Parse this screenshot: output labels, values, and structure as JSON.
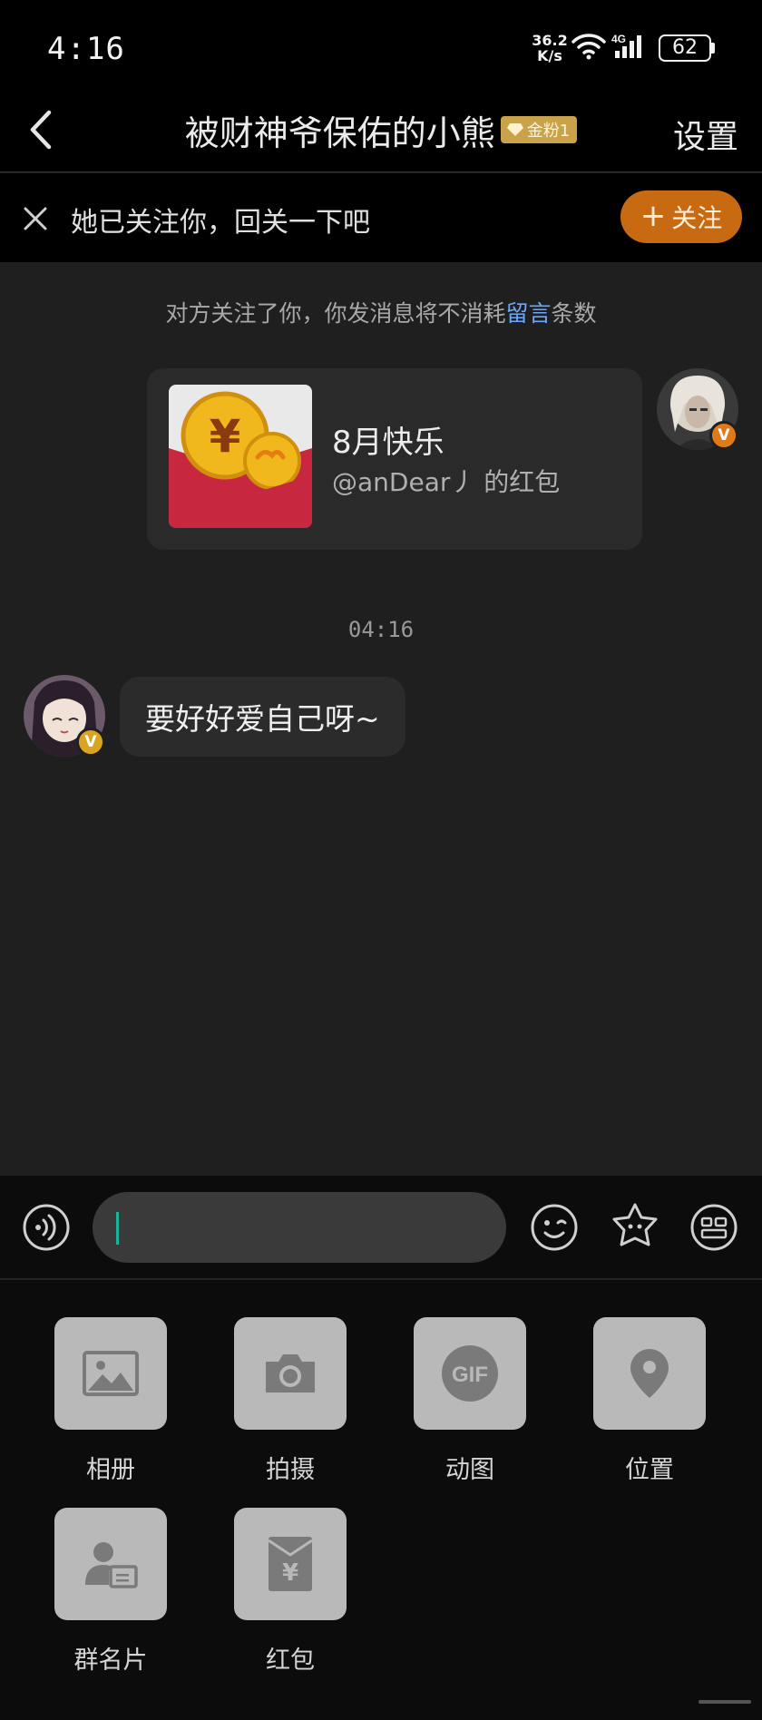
{
  "status_bar": {
    "time": "4:16",
    "net_speed_value": "36.2",
    "net_speed_unit": "K/s",
    "network_type": "4G",
    "battery": "62"
  },
  "header": {
    "title": "被财神爷保佑的小熊",
    "fan_badge": "金粉1",
    "settings_label": "设置"
  },
  "follow_bar": {
    "text": "她已关注你，回关一下吧",
    "button_label": "关注",
    "button_plus": "+"
  },
  "chat": {
    "notice_prefix": "对方关注了你，你发消息将不消耗",
    "notice_link": "留言",
    "notice_suffix": "条数",
    "red_packet": {
      "title": "8月快乐",
      "subtitle": "@anDear丿 的红包"
    },
    "timestamp": "04:16",
    "incoming_message": "要好好爱自己呀~",
    "verified_mark": "V"
  },
  "input": {
    "placeholder": "",
    "value": ""
  },
  "tools": [
    {
      "label": "相册",
      "icon": "image-icon"
    },
    {
      "label": "拍摄",
      "icon": "camera-icon"
    },
    {
      "label": "动图",
      "icon": "gif-icon"
    },
    {
      "label": "位置",
      "icon": "location-icon"
    },
    {
      "label": "群名片",
      "icon": "contact-card-icon"
    },
    {
      "label": "红包",
      "icon": "red-packet-icon"
    }
  ],
  "colors": {
    "background": "#1f1f1f",
    "follow_button": "#c86a12",
    "link": "#6aa7ff",
    "caret": "#19b39a",
    "fan_badge": "#c9a24a",
    "red_packet_red": "#c8283f",
    "coin_gold": "#f0b81c"
  }
}
